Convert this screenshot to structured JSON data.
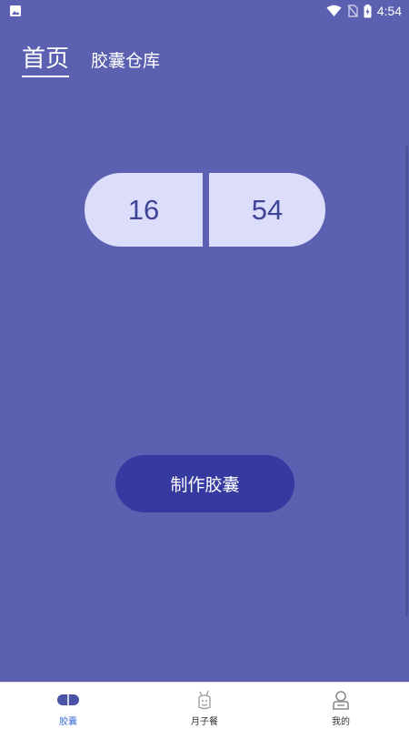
{
  "status_bar": {
    "time": "4:54",
    "icons": [
      "image-notification-icon",
      "wifi-icon",
      "no-sim-icon",
      "battery-charging-icon"
    ]
  },
  "top_tabs": [
    {
      "label": "首页",
      "active": true
    },
    {
      "label": "胶囊仓库",
      "active": false
    }
  ],
  "capsule": {
    "left_value": "16",
    "right_value": "54"
  },
  "make_button": {
    "label": "制作胶囊"
  },
  "bottom_nav": [
    {
      "label": "胶囊",
      "icon": "capsule-icon",
      "active": true
    },
    {
      "label": "月子餐",
      "icon": "meal-icon",
      "active": false
    },
    {
      "label": "我的",
      "icon": "profile-icon",
      "active": false
    }
  ],
  "colors": {
    "background": "#5b61b0",
    "capsule_fill": "#dcdcfb",
    "capsule_text": "#404697",
    "button_fill": "#3539a0",
    "nav_active": "#3e6fd6"
  }
}
